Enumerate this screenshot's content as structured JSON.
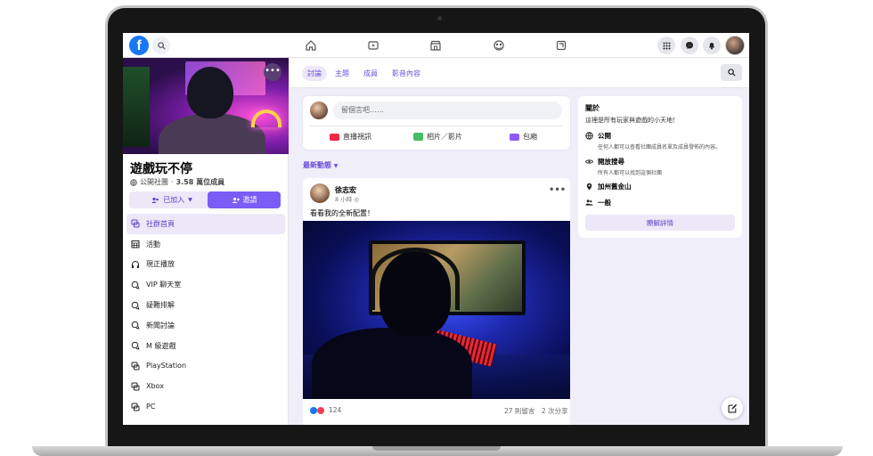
{
  "topbar": {
    "logo": "f"
  },
  "cover": {
    "more_label": "•••"
  },
  "group": {
    "name": "遊戲玩不停",
    "privacy": "公開社團",
    "members": "3.58 萬位成員",
    "joined_label": "已加入",
    "invite_label": "邀請"
  },
  "menu": [
    {
      "label": "社群首頁",
      "icon": "community-home-icon"
    },
    {
      "label": "活動",
      "icon": "calendar-icon"
    },
    {
      "label": "現正播放",
      "icon": "headphones-icon"
    },
    {
      "label": "VIP 聊天室",
      "icon": "chat-icon"
    },
    {
      "label": "疑難排解",
      "icon": "chat-icon"
    },
    {
      "label": "新聞討論",
      "icon": "chat-icon"
    },
    {
      "label": "M 級遊戲",
      "icon": "chat-icon"
    },
    {
      "label": "PlayStation",
      "icon": "channel-icon"
    },
    {
      "label": "Xbox",
      "icon": "channel-icon"
    },
    {
      "label": "PC",
      "icon": "channel-icon"
    }
  ],
  "tabs": [
    "討論",
    "主題",
    "成員",
    "影音內容"
  ],
  "composer": {
    "placeholder": "留個言吧……",
    "live": "直播視訊",
    "photo": "相片／影片",
    "room": "包廂"
  },
  "feed": {
    "sort_label": "最新動態"
  },
  "post": {
    "author": "徐志宏",
    "time": "8 小時",
    "text": "看看我的全新配置！",
    "reactions": "124",
    "stats": "27 則留言　2 次分享"
  },
  "about": {
    "title": "關於",
    "desc": "這裡是所有玩家與遊戲的小天地！",
    "public_title": "公開",
    "public_desc": "任何人都可以查看社團成員名單及成員發佈的內容。",
    "visible_title": "開放搜尋",
    "visible_desc": "所有人都可以找到這個社團",
    "location": "加州舊金山",
    "type": "一般",
    "learn_more": "瞭解詳情"
  },
  "colors": {
    "accent": "#7b5cf5",
    "brand": "#1877f2",
    "tab_text": "#6a4fdc"
  }
}
